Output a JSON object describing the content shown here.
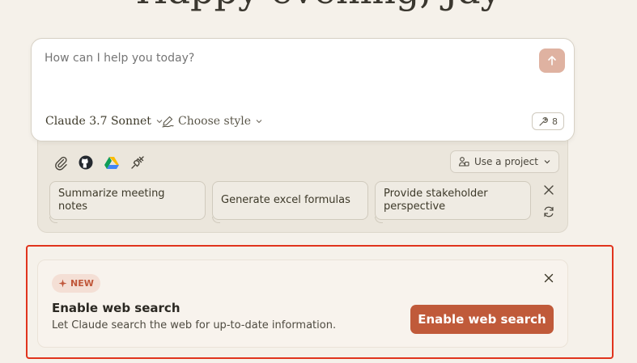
{
  "greeting": {
    "text": "Happy evening, Jay"
  },
  "composer": {
    "placeholder": "How can I help you today?",
    "model_label": "Claude 3.7 Sonnet",
    "style_label": "Choose style",
    "tools_count": "8"
  },
  "tray": {
    "project_label": "Use a project",
    "suggestions": [
      {
        "label": "Summarize meeting notes"
      },
      {
        "label": "Generate excel formulas"
      },
      {
        "label": "Provide stakeholder perspective"
      }
    ],
    "icons": [
      "paperclip-icon",
      "github-icon",
      "google-drive-icon",
      "plug-icon"
    ]
  },
  "promo": {
    "badge": "NEW",
    "title": "Enable web search",
    "description": "Let Claude search the web for up-to-date information.",
    "button_label": "Enable web search"
  },
  "colors": {
    "background": "#f5f1ea",
    "accent": "#c05a3a",
    "highlight": "#e0341d",
    "send_button": "#dfb2a1"
  }
}
